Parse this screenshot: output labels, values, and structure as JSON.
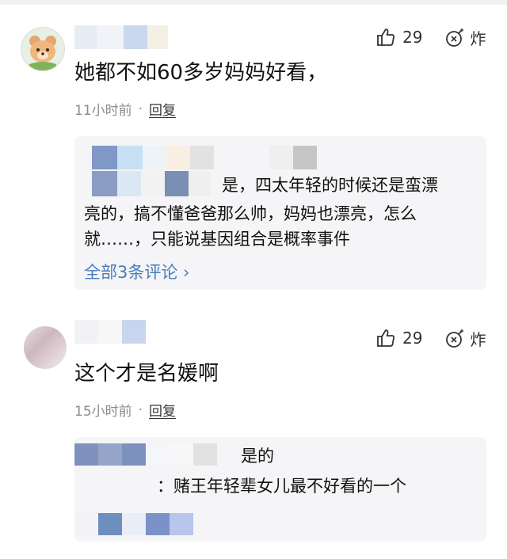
{
  "comments": [
    {
      "content": "她都不如60多岁妈妈好看，",
      "time": "11小时前",
      "dot": "·",
      "reply_label": "回复",
      "likes": "29",
      "bomb_label": "炸",
      "reply_box": {
        "text_line1": "是，四太年轻的时候还是蛮漂",
        "text_line2": "亮的，搞不懂爸爸那么帅，妈妈也漂亮，怎么",
        "text_line3": "就……，只能说基因组合是概率事件",
        "view_all": "全部3条评论 ›"
      }
    },
    {
      "content": "这个才是名媛啊",
      "time": "15小时前",
      "dot": "·",
      "reply_label": "回复",
      "likes": "29",
      "bomb_label": "炸",
      "reply_box": {
        "text_line1": "是的",
        "text_line2": "：赌王年轻辈女儿最不好看的一个"
      }
    }
  ],
  "icons": {
    "like": "thumbs-up-icon",
    "bomb": "bomb-icon",
    "avatar1": "bear-avatar",
    "avatar2": "photo-avatar"
  },
  "colors": {
    "link": "#4a7bbd",
    "meta": "#8c8c8c",
    "reply_bg": "#f5f5f7"
  }
}
